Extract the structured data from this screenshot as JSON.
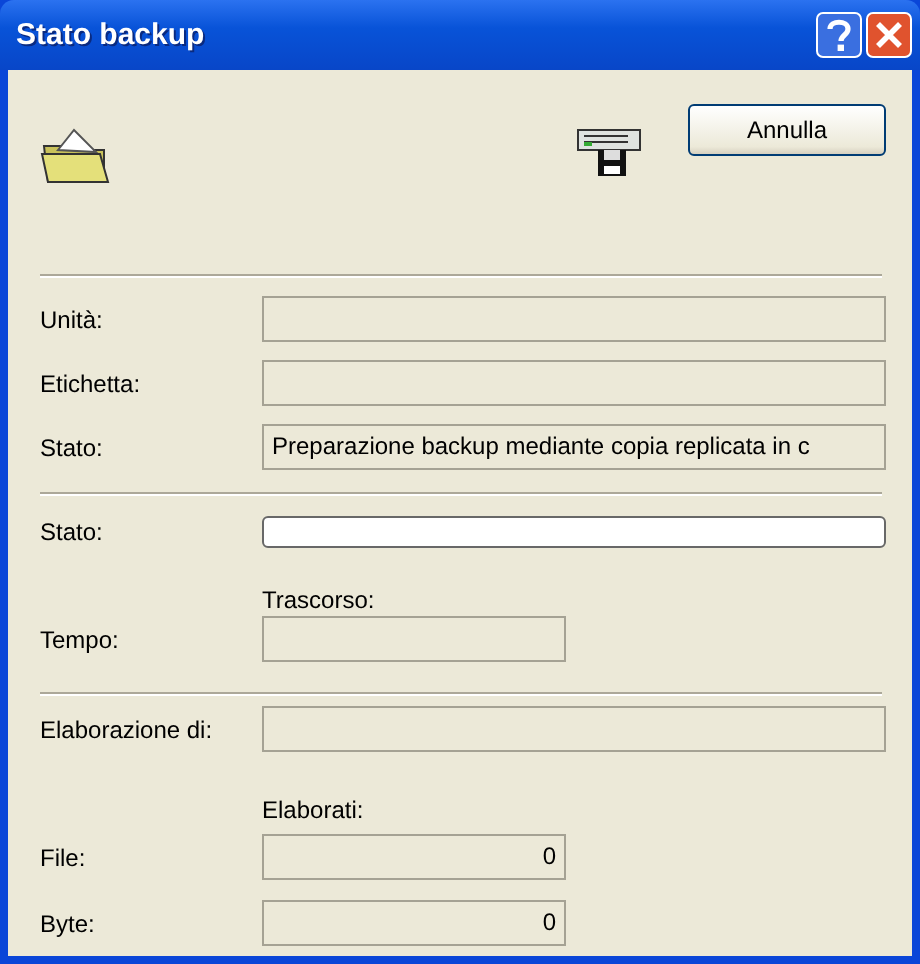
{
  "window": {
    "title": "Stato backup"
  },
  "cancel_button": "Annulla",
  "media_fields": [
    {
      "label": "Unità:"
    },
    {
      "label": "Etichetta:"
    },
    {
      "label": "Stato:",
      "value": "Preparazione backup mediante copia replicata in c"
    }
  ],
  "progress": {
    "label": "Stato:",
    "level": 0
  },
  "time": {
    "column_heading": "Trascorso:",
    "label": "Tempo:"
  },
  "processing": {
    "label": "Elaborazione di:"
  },
  "counts": {
    "column_heading": "Elaborati:",
    "rows": [
      {
        "label": "File:",
        "value": "0"
      },
      {
        "label": "Byte:",
        "value": "0"
      }
    ]
  }
}
